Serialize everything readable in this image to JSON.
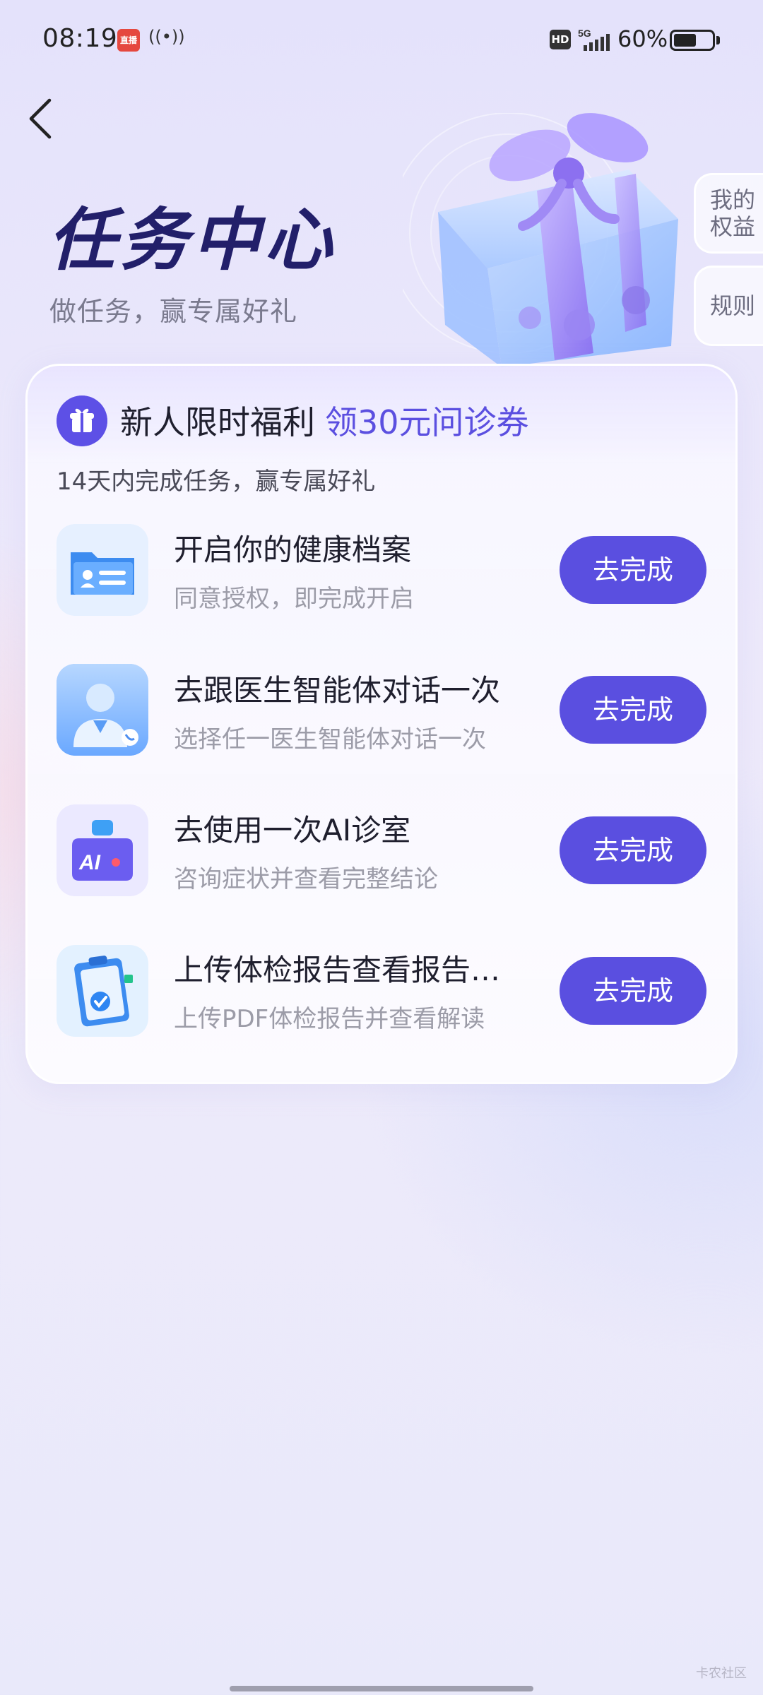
{
  "status_bar": {
    "time": "08:19",
    "app_badge": "直播",
    "battery": "60%",
    "network": "5G",
    "hd": "HD",
    "battery_level": 0.6
  },
  "header": {
    "title": "任务中心",
    "subtitle": "做任务，赢专属好礼"
  },
  "side_tabs": [
    {
      "label": "我的权益"
    },
    {
      "label": "规则"
    }
  ],
  "card": {
    "heading": "新人限时福利",
    "highlight": "领30元问诊券",
    "subtitle": "14天内完成任务，赢专属好礼"
  },
  "tasks": [
    {
      "title": "开启你的健康档案",
      "desc": "同意授权，即完成开启",
      "button": "去完成",
      "icon": "health-record-icon"
    },
    {
      "title": "去跟医生智能体对话一次",
      "desc": "选择任一医生智能体对话一次",
      "button": "去完成",
      "icon": "doctor-agent-icon"
    },
    {
      "title": "去使用一次AI诊室",
      "desc": "咨询症状并查看完整结论",
      "button": "去完成",
      "icon": "ai-clinic-icon"
    },
    {
      "title": "上传体检报告查看报告…",
      "desc": "上传PDF体检报告并查看解读",
      "button": "去完成",
      "icon": "report-clipboard-icon"
    }
  ],
  "watermark": "卡农社区",
  "colors": {
    "accent": "#5a4fe0",
    "title": "#221f6a"
  }
}
